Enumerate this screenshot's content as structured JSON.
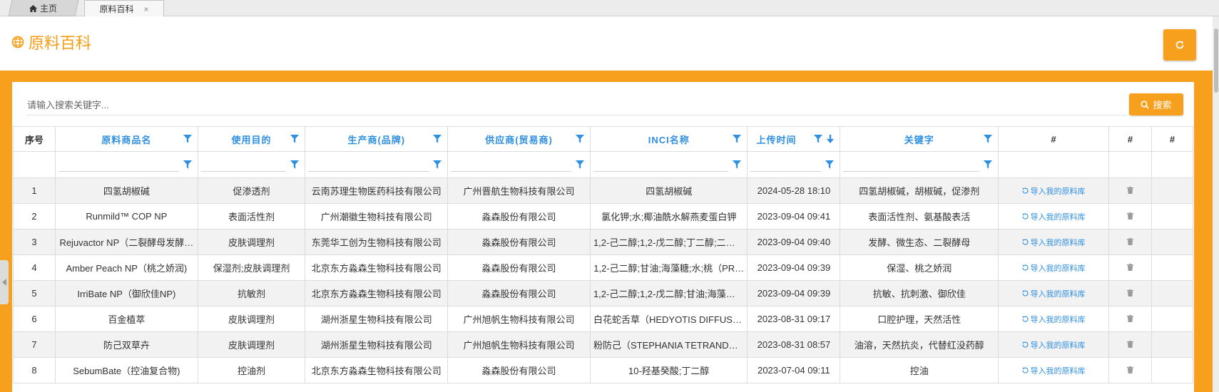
{
  "tabs": [
    {
      "label": "主页",
      "icon": "home-icon"
    },
    {
      "label": "原料百科",
      "close": "×"
    }
  ],
  "header": {
    "title": "原料百科",
    "title_icon": "globe-icon",
    "refresh_icon": "refresh-icon"
  },
  "search": {
    "placeholder": "请输入搜索关键字...",
    "button_label": "搜索",
    "button_icon": "search-icon"
  },
  "colors": {
    "accent": "#f7a01e",
    "title": "#f79b10",
    "link": "#2f8fe0"
  },
  "table": {
    "columns": [
      "序号",
      "原料商品名",
      "使用目的",
      "生产商(品牌)",
      "供应商(贸易商)",
      "INCI名称",
      "上传时间",
      "关键字",
      "#",
      "#",
      "#"
    ],
    "import_label": "导入我的原料库",
    "rows": [
      {
        "no": "1",
        "name": "四氢胡椒碱",
        "purpose": "促渗透剂",
        "maker": "云南苏理生物医药科技有限公司",
        "supplier": "广州晋航生物科技有限公司",
        "inci": "四氢胡椒碱",
        "time": "2024-05-28 18:10",
        "keywords": "四氢胡椒碱，胡椒碱，促渗剂"
      },
      {
        "no": "2",
        "name": "Runmild™ COP NP",
        "purpose": "表面活性剂",
        "maker": "广州潮徽生物科技有限公司",
        "supplier": "淼森股份有限公司",
        "inci": "氯化钾;水;椰油酰水解燕麦蛋白钾",
        "time": "2023-09-04 09:41",
        "keywords": "表面活性剂、氨基酸表活"
      },
      {
        "no": "3",
        "name": "Rejuvactor NP（二裂酵母发酵…",
        "purpose": "皮肤调理剂",
        "maker": "东莞华工创为生物科技有限公司",
        "supplier": "淼森股份有限公司",
        "inci": "1,2-己二醇;1,2-戊二醇;丁二醇;二裂…",
        "time": "2023-09-04 09:40",
        "keywords": "发酵、微生态、二裂酵母"
      },
      {
        "no": "4",
        "name": "Amber Peach NP（桃之娇润)",
        "purpose": "保湿剂;皮肤调理剂",
        "maker": "北京东方淼森生物科技有限公司",
        "supplier": "淼森股份有限公司",
        "inci": "1,2-己二醇;甘油;海藻糖;水;桃（PR…",
        "time": "2023-09-04 09:39",
        "keywords": "保湿、桃之娇润"
      },
      {
        "no": "5",
        "name": "IrriBate NP（御欣佳NP)",
        "purpose": "抗敏剂",
        "maker": "北京东方淼森生物科技有限公司",
        "supplier": "淼森股份有限公司",
        "inci": "1,2-己二醇;1,2-戊二醇;甘油;海藻糖;…",
        "time": "2023-09-04 09:39",
        "keywords": "抗敏、抗刺激、御欣佳"
      },
      {
        "no": "6",
        "name": "百金植萃",
        "purpose": "皮肤调理剂",
        "maker": "湖州浙星生物科技有限公司",
        "supplier": "广州旭帆生物科技有限公司",
        "inci": "白花蛇舌草（HEDYOTIS DIFFUSA…",
        "time": "2023-08-31 09:17",
        "keywords": "口腔护理，天然活性"
      },
      {
        "no": "7",
        "name": "防己双草卉",
        "purpose": "皮肤调理剂",
        "maker": "湖州浙星生物科技有限公司",
        "supplier": "广州旭帆生物科技有限公司",
        "inci": "粉防己（STEPHANIA TETRANDR…",
        "time": "2023-08-31 08:57",
        "keywords": "油溶，天然抗炎，代替红没药醇"
      },
      {
        "no": "8",
        "name": "SebumBate（控油复合物)",
        "purpose": "控油剂",
        "maker": "北京东方淼森生物科技有限公司",
        "supplier": "淼森股份有限公司",
        "inci": "10-羟基癸酸;丁二醇",
        "time": "2023-07-04 09:11",
        "keywords": "控油"
      }
    ]
  }
}
